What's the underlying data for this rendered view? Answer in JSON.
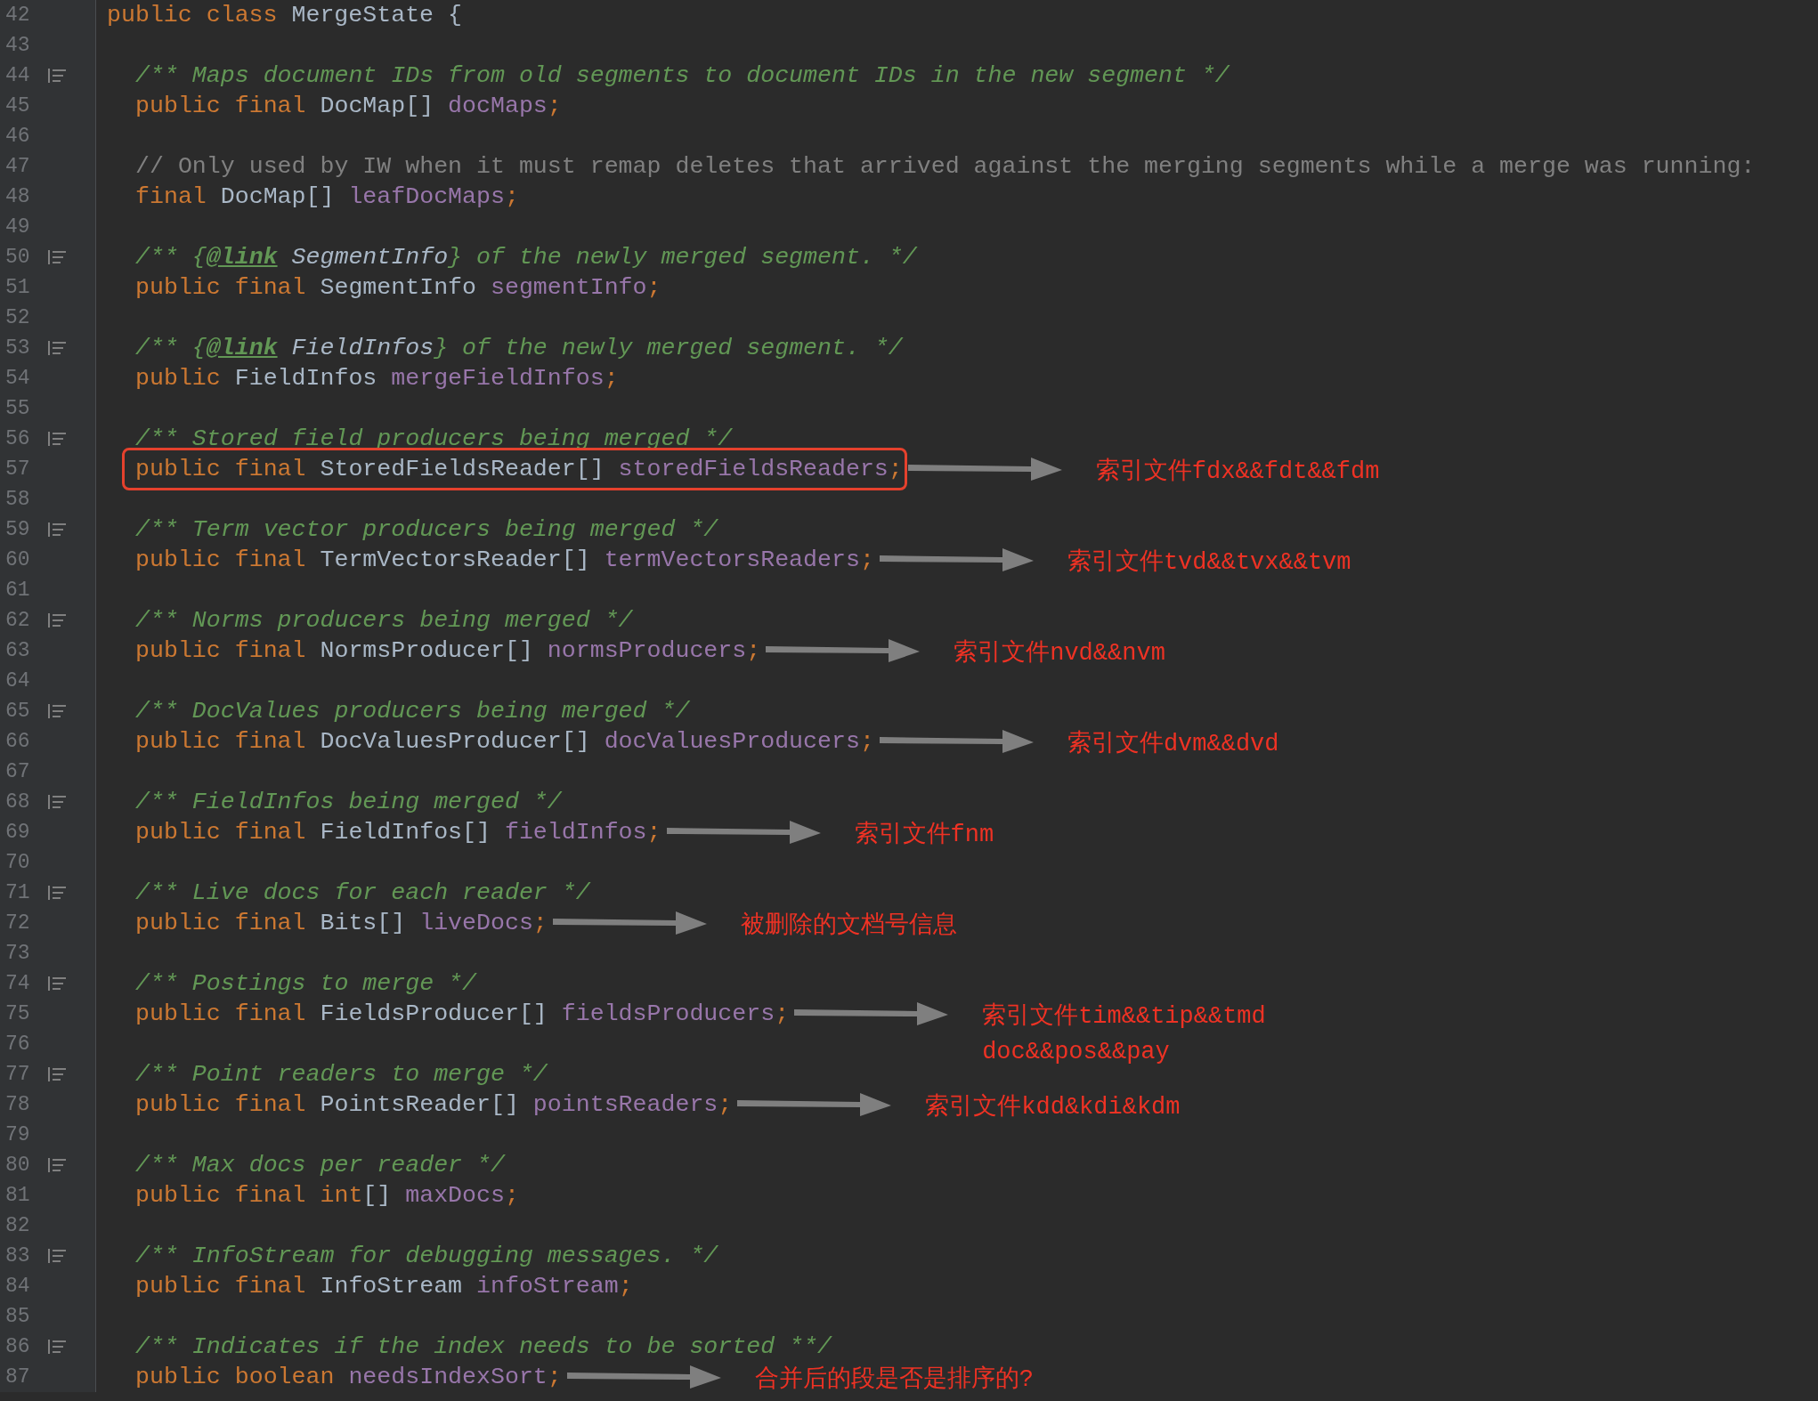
{
  "lines": [
    {
      "number": "42",
      "tokens": [
        {
          "kind": "keyword",
          "text": "public class "
        },
        {
          "kind": "type",
          "text": "MergeState {"
        }
      ],
      "children": [
        {
          "number": "43"
        },
        {
          "number": "44",
          "gutter_icon": true,
          "tokens": [
            {
              "kind": "doc",
              "text": "/** Maps document IDs from old segments to document IDs in the new segment */"
            }
          ]
        },
        {
          "number": "45",
          "tokens": [
            {
              "kind": "keyword",
              "text": "public final "
            },
            {
              "kind": "type",
              "text": "DocMap[] "
            },
            {
              "kind": "field",
              "text": "docMaps"
            },
            {
              "kind": "keyword",
              "text": ";"
            }
          ]
        },
        {
          "number": "46"
        },
        {
          "number": "47",
          "tokens": [
            {
              "kind": "comment",
              "text": "// Only used by IW when it must remap deletes that arrived against the merging segments while a merge was running:"
            }
          ]
        },
        {
          "number": "48",
          "tokens": [
            {
              "kind": "keyword",
              "text": "final "
            },
            {
              "kind": "type",
              "text": "DocMap[] "
            },
            {
              "kind": "field",
              "text": "leafDocMaps"
            },
            {
              "kind": "keyword",
              "text": ";"
            }
          ]
        },
        {
          "number": "49"
        },
        {
          "number": "50",
          "gutter_icon": true,
          "tokens": [
            {
              "kind": "doc",
              "text": "/** {"
            },
            {
              "kind": "doctag",
              "text": "@link"
            },
            {
              "kind": "docref",
              "text": " SegmentInfo"
            },
            {
              "kind": "doc",
              "text": "} of the newly merged segment. */"
            }
          ]
        },
        {
          "number": "51",
          "tokens": [
            {
              "kind": "keyword",
              "text": "public final "
            },
            {
              "kind": "type",
              "text": "SegmentInfo "
            },
            {
              "kind": "field",
              "text": "segmentInfo"
            },
            {
              "kind": "keyword",
              "text": ";"
            }
          ]
        },
        {
          "number": "52"
        },
        {
          "number": "53",
          "gutter_icon": true,
          "tokens": [
            {
              "kind": "doc",
              "text": "/** {"
            },
            {
              "kind": "doctag",
              "text": "@link"
            },
            {
              "kind": "docref",
              "text": " FieldInfos"
            },
            {
              "kind": "doc",
              "text": "} of the newly merged segment. */"
            }
          ]
        },
        {
          "number": "54",
          "tokens": [
            {
              "kind": "keyword",
              "text": "public "
            },
            {
              "kind": "type",
              "text": "FieldInfos "
            },
            {
              "kind": "field",
              "text": "mergeFieldInfos"
            },
            {
              "kind": "keyword",
              "text": ";"
            }
          ]
        },
        {
          "number": "55"
        },
        {
          "number": "56",
          "gutter_icon": true,
          "tokens": [
            {
              "kind": "doc",
              "text": "/** Stored field producers being merged */"
            }
          ]
        },
        {
          "number": "57",
          "highlighted": true,
          "tokens": [
            {
              "kind": "keyword",
              "text": "public final "
            },
            {
              "kind": "type",
              "text": "StoredFieldsReader[] "
            },
            {
              "kind": "field",
              "text": "storedFieldsReaders"
            },
            {
              "kind": "keyword",
              "text": ";"
            }
          ],
          "note": [
            "索引文件fdx&&fdt&&fdm"
          ]
        },
        {
          "number": "58"
        },
        {
          "number": "59",
          "gutter_icon": true,
          "tokens": [
            {
              "kind": "doc",
              "text": "/** Term vector producers being merged */"
            }
          ]
        },
        {
          "number": "60",
          "tokens": [
            {
              "kind": "keyword",
              "text": "public final "
            },
            {
              "kind": "type",
              "text": "TermVectorsReader[] "
            },
            {
              "kind": "field",
              "text": "termVectorsReaders"
            },
            {
              "kind": "keyword",
              "text": ";"
            }
          ],
          "note": [
            "索引文件tvd&&tvx&&tvm"
          ]
        },
        {
          "number": "61"
        },
        {
          "number": "62",
          "gutter_icon": true,
          "tokens": [
            {
              "kind": "doc",
              "text": "/** Norms producers being merged */"
            }
          ]
        },
        {
          "number": "63",
          "tokens": [
            {
              "kind": "keyword",
              "text": "public final "
            },
            {
              "kind": "type",
              "text": "NormsProducer[] "
            },
            {
              "kind": "field",
              "text": "normsProducers"
            },
            {
              "kind": "keyword",
              "text": ";"
            }
          ],
          "note": [
            "索引文件nvd&&nvm"
          ]
        },
        {
          "number": "64"
        },
        {
          "number": "65",
          "gutter_icon": true,
          "tokens": [
            {
              "kind": "doc",
              "text": "/** DocValues producers being merged */"
            }
          ]
        },
        {
          "number": "66",
          "tokens": [
            {
              "kind": "keyword",
              "text": "public final "
            },
            {
              "kind": "type",
              "text": "DocValuesProducer[] "
            },
            {
              "kind": "field",
              "text": "docValuesProducers"
            },
            {
              "kind": "keyword",
              "text": ";"
            }
          ],
          "note": [
            "索引文件dvm&&dvd"
          ]
        },
        {
          "number": "67"
        },
        {
          "number": "68",
          "gutter_icon": true,
          "tokens": [
            {
              "kind": "doc",
              "text": "/** FieldInfos being merged */"
            }
          ]
        },
        {
          "number": "69",
          "tokens": [
            {
              "kind": "keyword",
              "text": "public final "
            },
            {
              "kind": "type",
              "text": "FieldInfos[] "
            },
            {
              "kind": "field",
              "text": "fieldInfos"
            },
            {
              "kind": "keyword",
              "text": ";"
            }
          ],
          "note": [
            "索引文件fnm"
          ]
        },
        {
          "number": "70"
        },
        {
          "number": "71",
          "gutter_icon": true,
          "tokens": [
            {
              "kind": "doc",
              "text": "/** Live docs for each reader */"
            }
          ]
        },
        {
          "number": "72",
          "tokens": [
            {
              "kind": "keyword",
              "text": "public final "
            },
            {
              "kind": "type",
              "text": "Bits[] "
            },
            {
              "kind": "field",
              "text": "liveDocs"
            },
            {
              "kind": "keyword",
              "text": ";"
            }
          ],
          "note": [
            "被删除的文档号信息"
          ]
        },
        {
          "number": "73"
        },
        {
          "number": "74",
          "gutter_icon": true,
          "tokens": [
            {
              "kind": "doc",
              "text": "/** Postings to merge */"
            }
          ]
        },
        {
          "number": "75",
          "tokens": [
            {
              "kind": "keyword",
              "text": "public final "
            },
            {
              "kind": "type",
              "text": "FieldsProducer[] "
            },
            {
              "kind": "field",
              "text": "fieldsProducers"
            },
            {
              "kind": "keyword",
              "text": ";"
            }
          ],
          "note": [
            "索引文件tim&&tip&&tmd",
            "doc&&pos&&pay"
          ]
        },
        {
          "number": "76"
        },
        {
          "number": "77",
          "gutter_icon": true,
          "tokens": [
            {
              "kind": "doc",
              "text": "/** Point readers to merge */"
            }
          ]
        },
        {
          "number": "78",
          "tokens": [
            {
              "kind": "keyword",
              "text": "public final "
            },
            {
              "kind": "type",
              "text": "PointsReader[] "
            },
            {
              "kind": "field",
              "text": "pointsReaders"
            },
            {
              "kind": "keyword",
              "text": ";"
            }
          ],
          "note": [
            "索引文件kdd&kdi&kdm"
          ]
        },
        {
          "number": "79"
        },
        {
          "number": "80",
          "gutter_icon": true,
          "tokens": [
            {
              "kind": "doc",
              "text": "/** Max docs per reader */"
            }
          ]
        },
        {
          "number": "81",
          "tokens": [
            {
              "kind": "keyword",
              "text": "public final int"
            },
            {
              "kind": "type",
              "text": "[] "
            },
            {
              "kind": "field",
              "text": "maxDocs"
            },
            {
              "kind": "keyword",
              "text": ";"
            }
          ]
        },
        {
          "number": "82"
        },
        {
          "number": "83",
          "gutter_icon": true,
          "tokens": [
            {
              "kind": "doc",
              "text": "/** InfoStream for debugging messages. */"
            }
          ]
        },
        {
          "number": "84",
          "tokens": [
            {
              "kind": "keyword",
              "text": "public final "
            },
            {
              "kind": "type",
              "text": "InfoStream "
            },
            {
              "kind": "field",
              "text": "infoStream"
            },
            {
              "kind": "keyword",
              "text": ";"
            }
          ]
        },
        {
          "number": "85"
        },
        {
          "number": "86",
          "gutter_icon": true,
          "tokens": [
            {
              "kind": "doc",
              "text": "/** Indicates if the index needs to be sorted **/"
            }
          ]
        },
        {
          "number": "87",
          "tokens": [
            {
              "kind": "keyword",
              "text": "public boolean "
            },
            {
              "kind": "field",
              "text": "needsIndexSort"
            },
            {
              "kind": "keyword",
              "text": ";"
            }
          ],
          "note": [
            "合并后的段是否是排序的?"
          ]
        }
      ]
    }
  ]
}
